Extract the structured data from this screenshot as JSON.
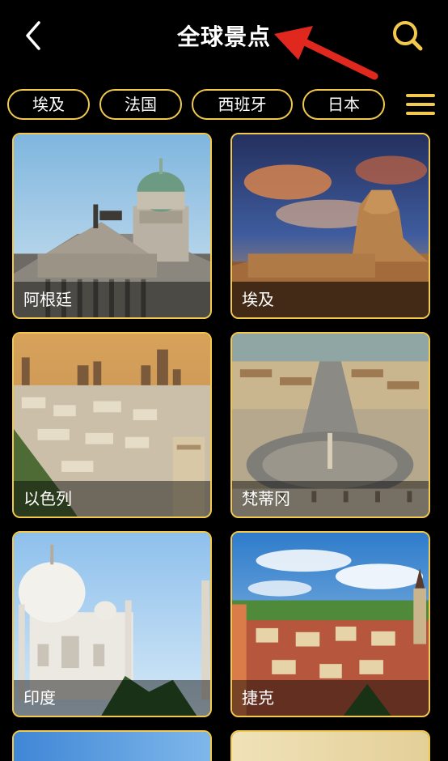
{
  "header": {
    "title": "全球景点",
    "back_icon": "chevron-left-icon",
    "search_icon": "search-icon"
  },
  "colors": {
    "background": "#000000",
    "accent": "#f2c94c",
    "annotation": "#e0281e"
  },
  "categories": {
    "items": [
      {
        "label": "埃及"
      },
      {
        "label": "法国"
      },
      {
        "label": "西班牙"
      },
      {
        "label": "日本"
      }
    ],
    "menu_icon": "hamburger-menu-icon"
  },
  "destinations": [
    {
      "label": "阿根廷"
    },
    {
      "label": "埃及"
    },
    {
      "label": "以色列"
    },
    {
      "label": "梵蒂冈"
    },
    {
      "label": "印度"
    },
    {
      "label": "捷克"
    }
  ]
}
